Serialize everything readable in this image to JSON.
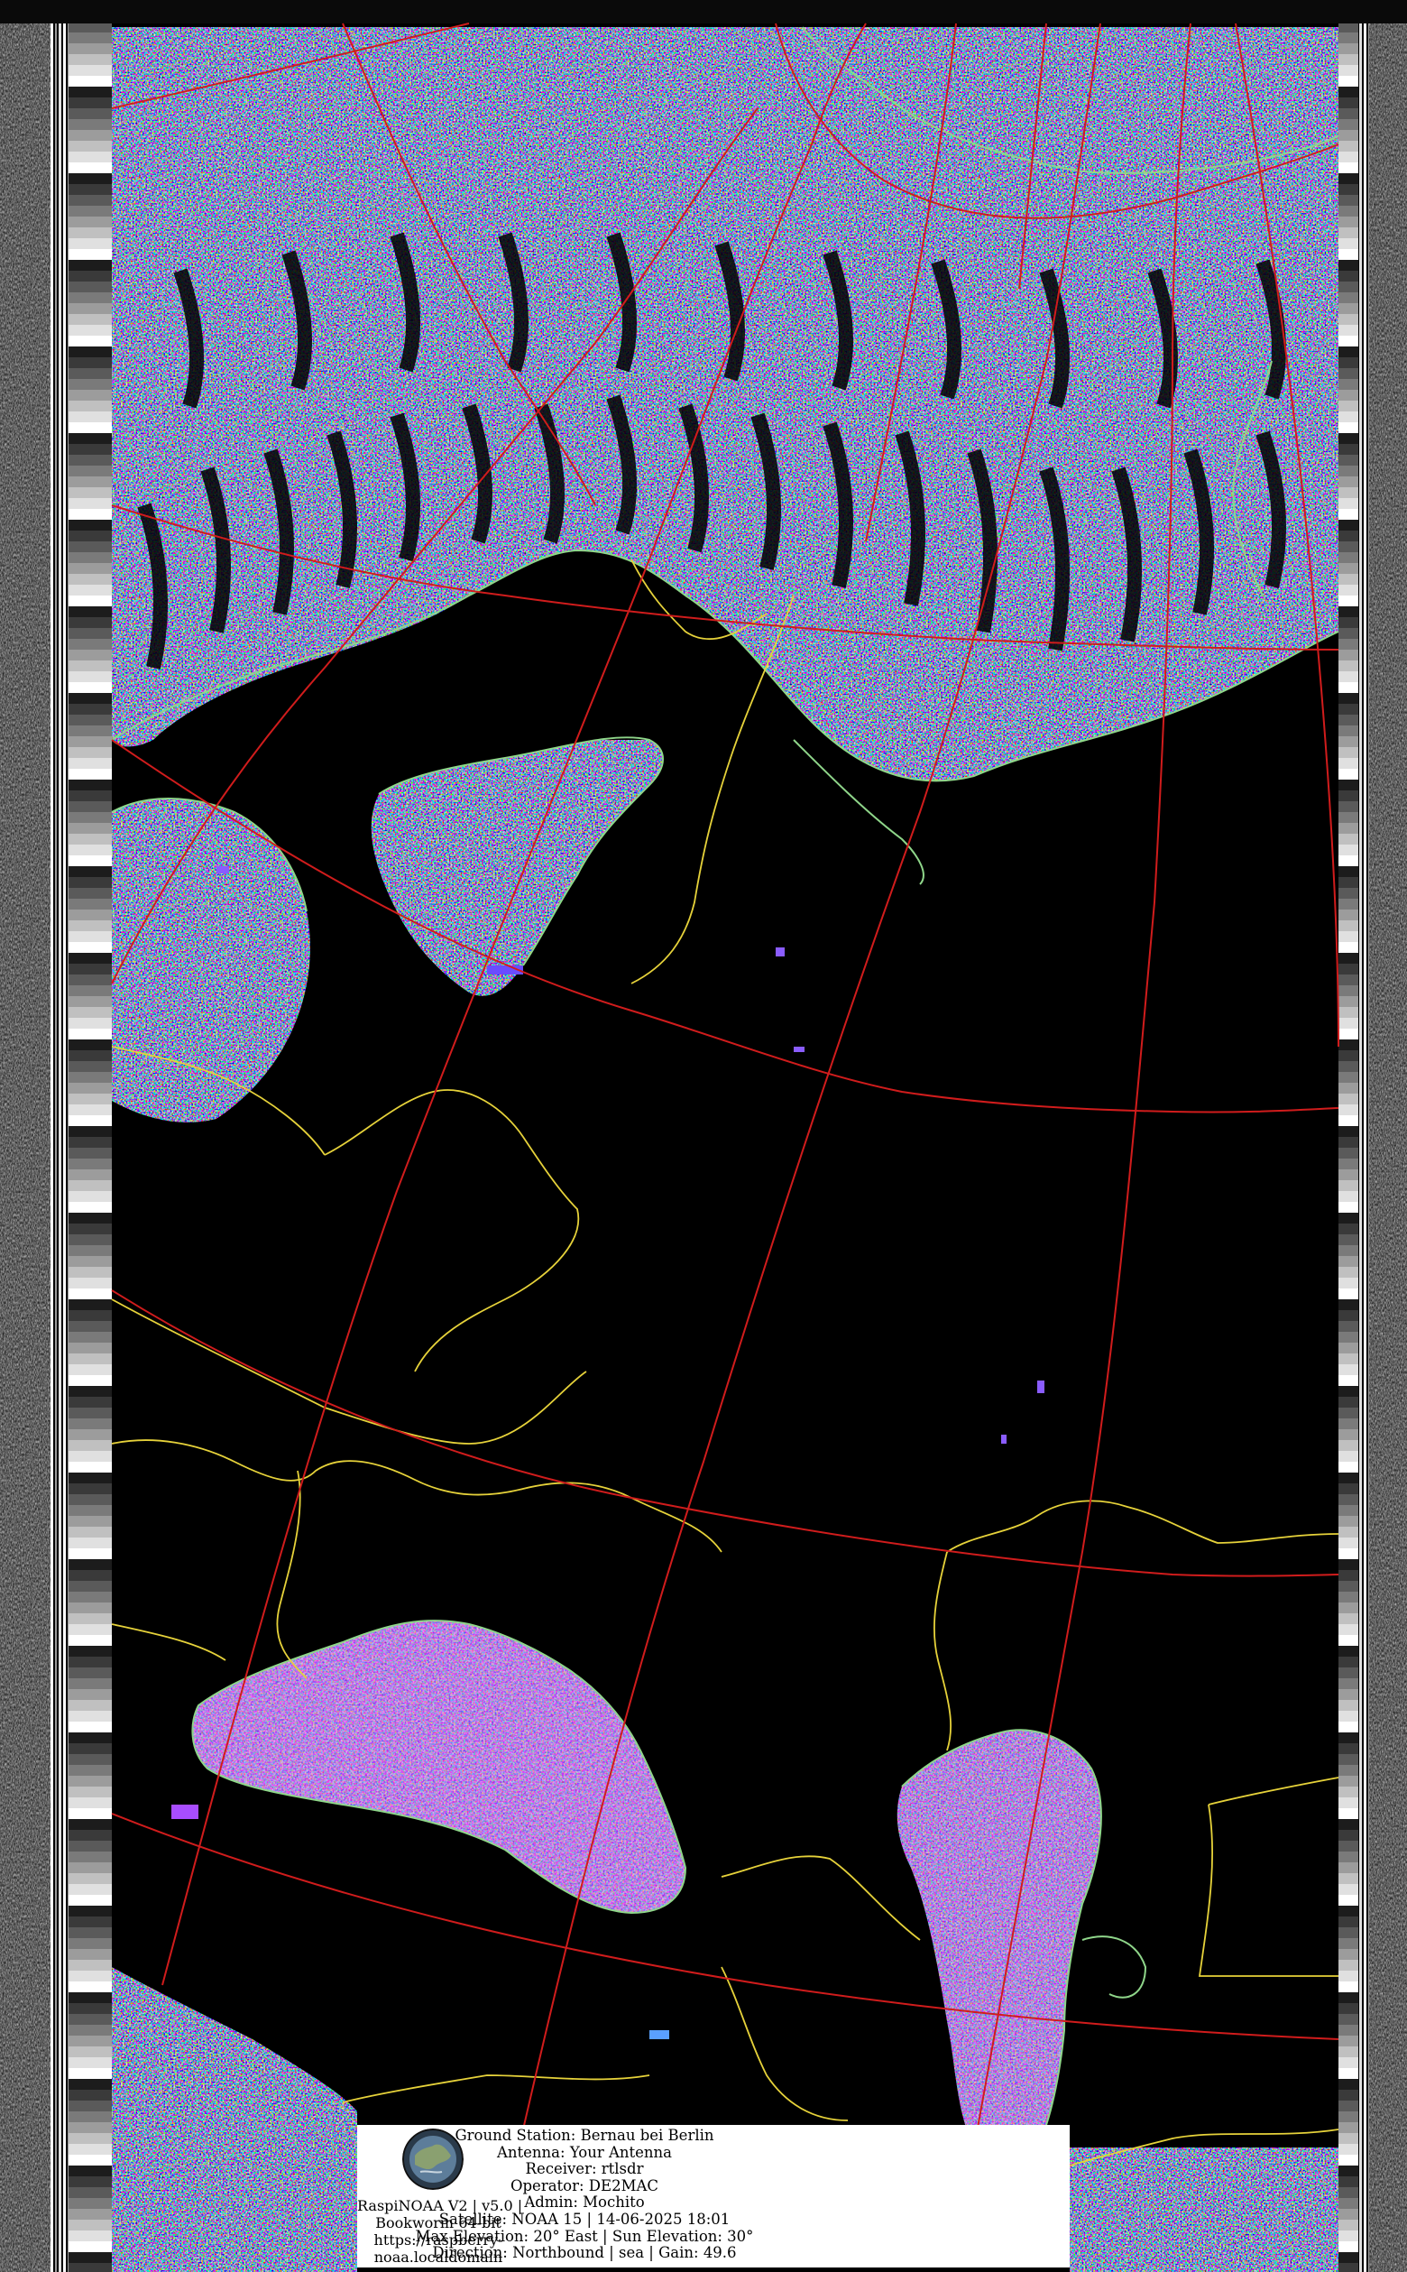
{
  "caption": {
    "app_line": "RaspiNOAA V2 | v5.0 |",
    "os_line": "Bookworm 64-bit",
    "url_line_1": "https://raspberry-",
    "url_line_2": "noaa.localdomain",
    "ground_station": "Ground Station: Bernau bei Berlin",
    "antenna": "Antenna: Your Antenna",
    "receiver": "Receiver: rtlsdr",
    "operator": "Operator: DE2MAC",
    "admin": "Admin: Mochito",
    "satellite": "Satellite: NOAA 15 | 14-06-2025 18:01",
    "elevation": "Max Elevation: 20° East | Sun Elevation: 30°",
    "direction": "Direction: Northbound | sea | Gain: 49.6"
  },
  "colors": {
    "background": "#000000",
    "graticule": "#d01c1c",
    "borders": "#e6d23a",
    "coastline": "#8fd68a",
    "noise_palette": [
      "#7fd0ff",
      "#f2e86a",
      "#7ee07a",
      "#5a6cff",
      "#a84dff",
      "#ff9a3c",
      "#e8e8e8"
    ]
  },
  "icons": {
    "logo": "raspinoaa-globe-logo"
  }
}
